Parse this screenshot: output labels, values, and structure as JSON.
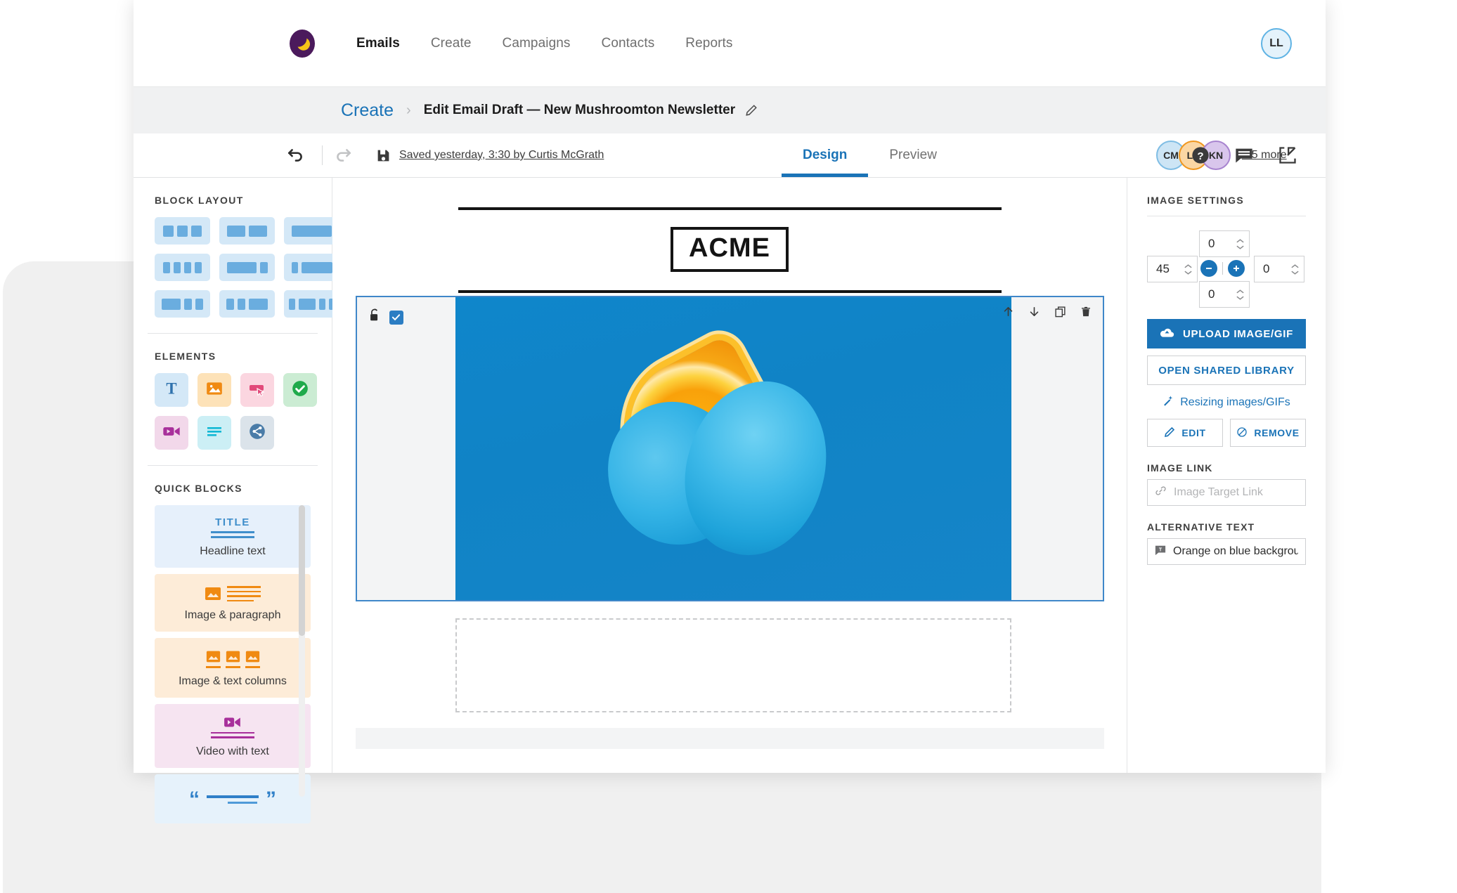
{
  "topnav": {
    "logo_icon": "crescent-moon-logo",
    "links": [
      {
        "label": "Emails",
        "active": true
      },
      {
        "label": "Create",
        "active": false
      },
      {
        "label": "Campaigns",
        "active": false
      },
      {
        "label": "Contacts",
        "active": false
      },
      {
        "label": "Reports",
        "active": false
      }
    ],
    "account_initials": "LL"
  },
  "breadcrumb": {
    "root": "Create",
    "separator": "›",
    "current": "Edit Email Draft — New Mushroomton Newsletter",
    "edit_icon": "pencil-icon"
  },
  "toolbar": {
    "undo_icon": "undo-arrow-icon",
    "redo_icon": "redo-arrow-icon",
    "save_icon": "floppy-disk-save-icon",
    "save_status": "Saved yesterday, 3:30 by Curtis McGrath",
    "tabs": [
      {
        "label": "Design",
        "active": true
      },
      {
        "label": "Preview",
        "active": false
      }
    ],
    "collaborators": [
      {
        "initials": "CM",
        "color": "#9dcdeb",
        "bg": "#cde5f5"
      },
      {
        "initials": "LN",
        "color": "#f0971f",
        "bg": "#fbd7a4"
      },
      {
        "initials": "KN",
        "color": "#a884cf",
        "bg": "#d9c6ec"
      }
    ],
    "more_collaborators": "+ 5 more",
    "help_icon": "help-circle-icon",
    "comments_icon": "comment-bubble-icon",
    "export_icon": "export-upload-icon"
  },
  "left_panel": {
    "block_layout_title": "BLOCK LAYOUT",
    "block_layouts": [
      {
        "name": "three-equal-columns",
        "widths": [
          22,
          22,
          22
        ]
      },
      {
        "name": "two-equal-columns",
        "widths": [
          30,
          30
        ]
      },
      {
        "name": "one-full-column",
        "widths": [
          62
        ]
      },
      {
        "name": "four-equal-columns",
        "widths": [
          13,
          13,
          13,
          13
        ]
      },
      {
        "name": "wide-left-narrow-right",
        "widths": [
          44,
          14
        ]
      },
      {
        "name": "narrow-left-wide-right",
        "widths": [
          10,
          48
        ]
      },
      {
        "name": "wide-left-two-narrow",
        "widths": [
          30,
          13,
          13
        ]
      },
      {
        "name": "two-narrow-wide-right",
        "widths": [
          13,
          13,
          30
        ]
      },
      {
        "name": "narrow-wide-narrow-narrow",
        "widths": [
          11,
          26,
          11,
          11
        ]
      }
    ],
    "elements_title": "ELEMENTS",
    "elements": [
      {
        "name": "text-element",
        "icon": "text-T-icon",
        "bg": "#d4e8f7",
        "fg": "#2f72ad"
      },
      {
        "name": "image-element",
        "icon": "image-picture-icon",
        "bg": "#fde2b8",
        "fg": "#f08a12"
      },
      {
        "name": "button-element",
        "icon": "button-cursor-icon",
        "bg": "#fbd6e0",
        "fg": "#e24a7a"
      },
      {
        "name": "confirm-element",
        "icon": "check-circle-icon",
        "bg": "#cbecd3",
        "fg": "#1faa4b"
      },
      {
        "name": "video-element",
        "icon": "video-camera-icon",
        "bg": "#f2d8ea",
        "fg": "#a8309b"
      },
      {
        "name": "divider-element",
        "icon": "text-lines-icon",
        "bg": "#cceff5",
        "fg": "#11b8d4"
      },
      {
        "name": "social-share-element",
        "icon": "share-network-icon",
        "bg": "#dbe3ea",
        "fg": "#4a7architecture"
      }
    ],
    "quick_blocks_title": "QUICK BLOCKS",
    "quick_blocks": [
      {
        "name": "headline-text",
        "label": "Headline text",
        "preview": "TITLE",
        "bg": "#e6f0fb",
        "fg": "#3f8ecb"
      },
      {
        "name": "image-and-paragraph",
        "label": "Image & paragraph",
        "preview": "",
        "bg": "#fdecd8",
        "fg": "#f08a12"
      },
      {
        "name": "image-and-text-columns",
        "label": "Image & text columns",
        "preview": "",
        "bg": "#fdecd8",
        "fg": "#f08a12"
      },
      {
        "name": "video-with-text",
        "label": "Video with text",
        "preview": "",
        "bg": "#f6e4f1",
        "fg": "#a8309b"
      },
      {
        "name": "quote-block",
        "label": "",
        "preview": "“ ”",
        "bg": "#e6f2fb",
        "fg": "#2f80c8"
      }
    ]
  },
  "canvas": {
    "header_logo_text": "ACME",
    "selected_block": {
      "lock_icon": "unlock-padlock-icon",
      "select_checkbox": "checked-checkbox-icon",
      "tools": [
        {
          "name": "move-up-button",
          "icon": "arrow-up-icon"
        },
        {
          "name": "move-down-button",
          "icon": "arrow-down-icon"
        },
        {
          "name": "duplicate-button",
          "icon": "copy-duplicate-icon"
        },
        {
          "name": "delete-button",
          "icon": "trash-can-icon"
        }
      ],
      "image_alt": "Orange on blue background"
    },
    "empty_dropzone_label": ""
  },
  "right_panel": {
    "title": "IMAGE SETTINGS",
    "padding": {
      "top": "0",
      "left": "45",
      "right": "0",
      "bottom": "0",
      "decrease_icon": "minus-circle-icon",
      "increase_icon": "plus-circle-icon"
    },
    "upload_button": "UPLOAD IMAGE/GIF",
    "upload_icon": "cloud-upload-icon",
    "shared_library_button": "OPEN SHARED LIBRARY",
    "resizing_link": "Resizing images/GIFs",
    "resizing_icon": "magic-wand-icon",
    "edit_button": "EDIT",
    "edit_icon": "pencil-icon",
    "remove_button": "REMOVE",
    "remove_icon": "no-entry-icon",
    "image_link_label": "IMAGE LINK",
    "image_link_icon": "chain-link-icon",
    "image_link_value": "",
    "image_link_placeholder": "Image Target Link",
    "alt_text_label": "ALTERNATIVE TEXT",
    "alt_text_icon": "alt-text-tag-icon",
    "alt_text_value": "Orange on blue background"
  }
}
